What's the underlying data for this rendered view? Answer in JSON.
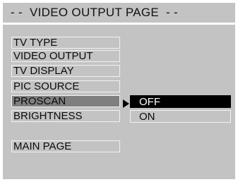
{
  "header": {
    "title": "- -  VIDEO OUTPUT PAGE  - -"
  },
  "menu": {
    "items": [
      {
        "label": "TV TYPE"
      },
      {
        "label": "VIDEO OUTPUT"
      },
      {
        "label": "TV DISPLAY"
      },
      {
        "label": "PIC SOURCE"
      },
      {
        "label": "PROSCAN",
        "selected": true
      },
      {
        "label": "BRIGHTNESS"
      }
    ],
    "main_page": "MAIN PAGE"
  },
  "submenu": {
    "options": [
      {
        "label": "OFF",
        "highlighted": true
      },
      {
        "label": "ON",
        "highlighted": false
      }
    ]
  },
  "colors": {
    "background": "#c3c3c3",
    "selected_item": "#7f7f7f",
    "highlight": "#000000",
    "highlight_text": "#ffffff",
    "border": "#f2f2f2"
  }
}
